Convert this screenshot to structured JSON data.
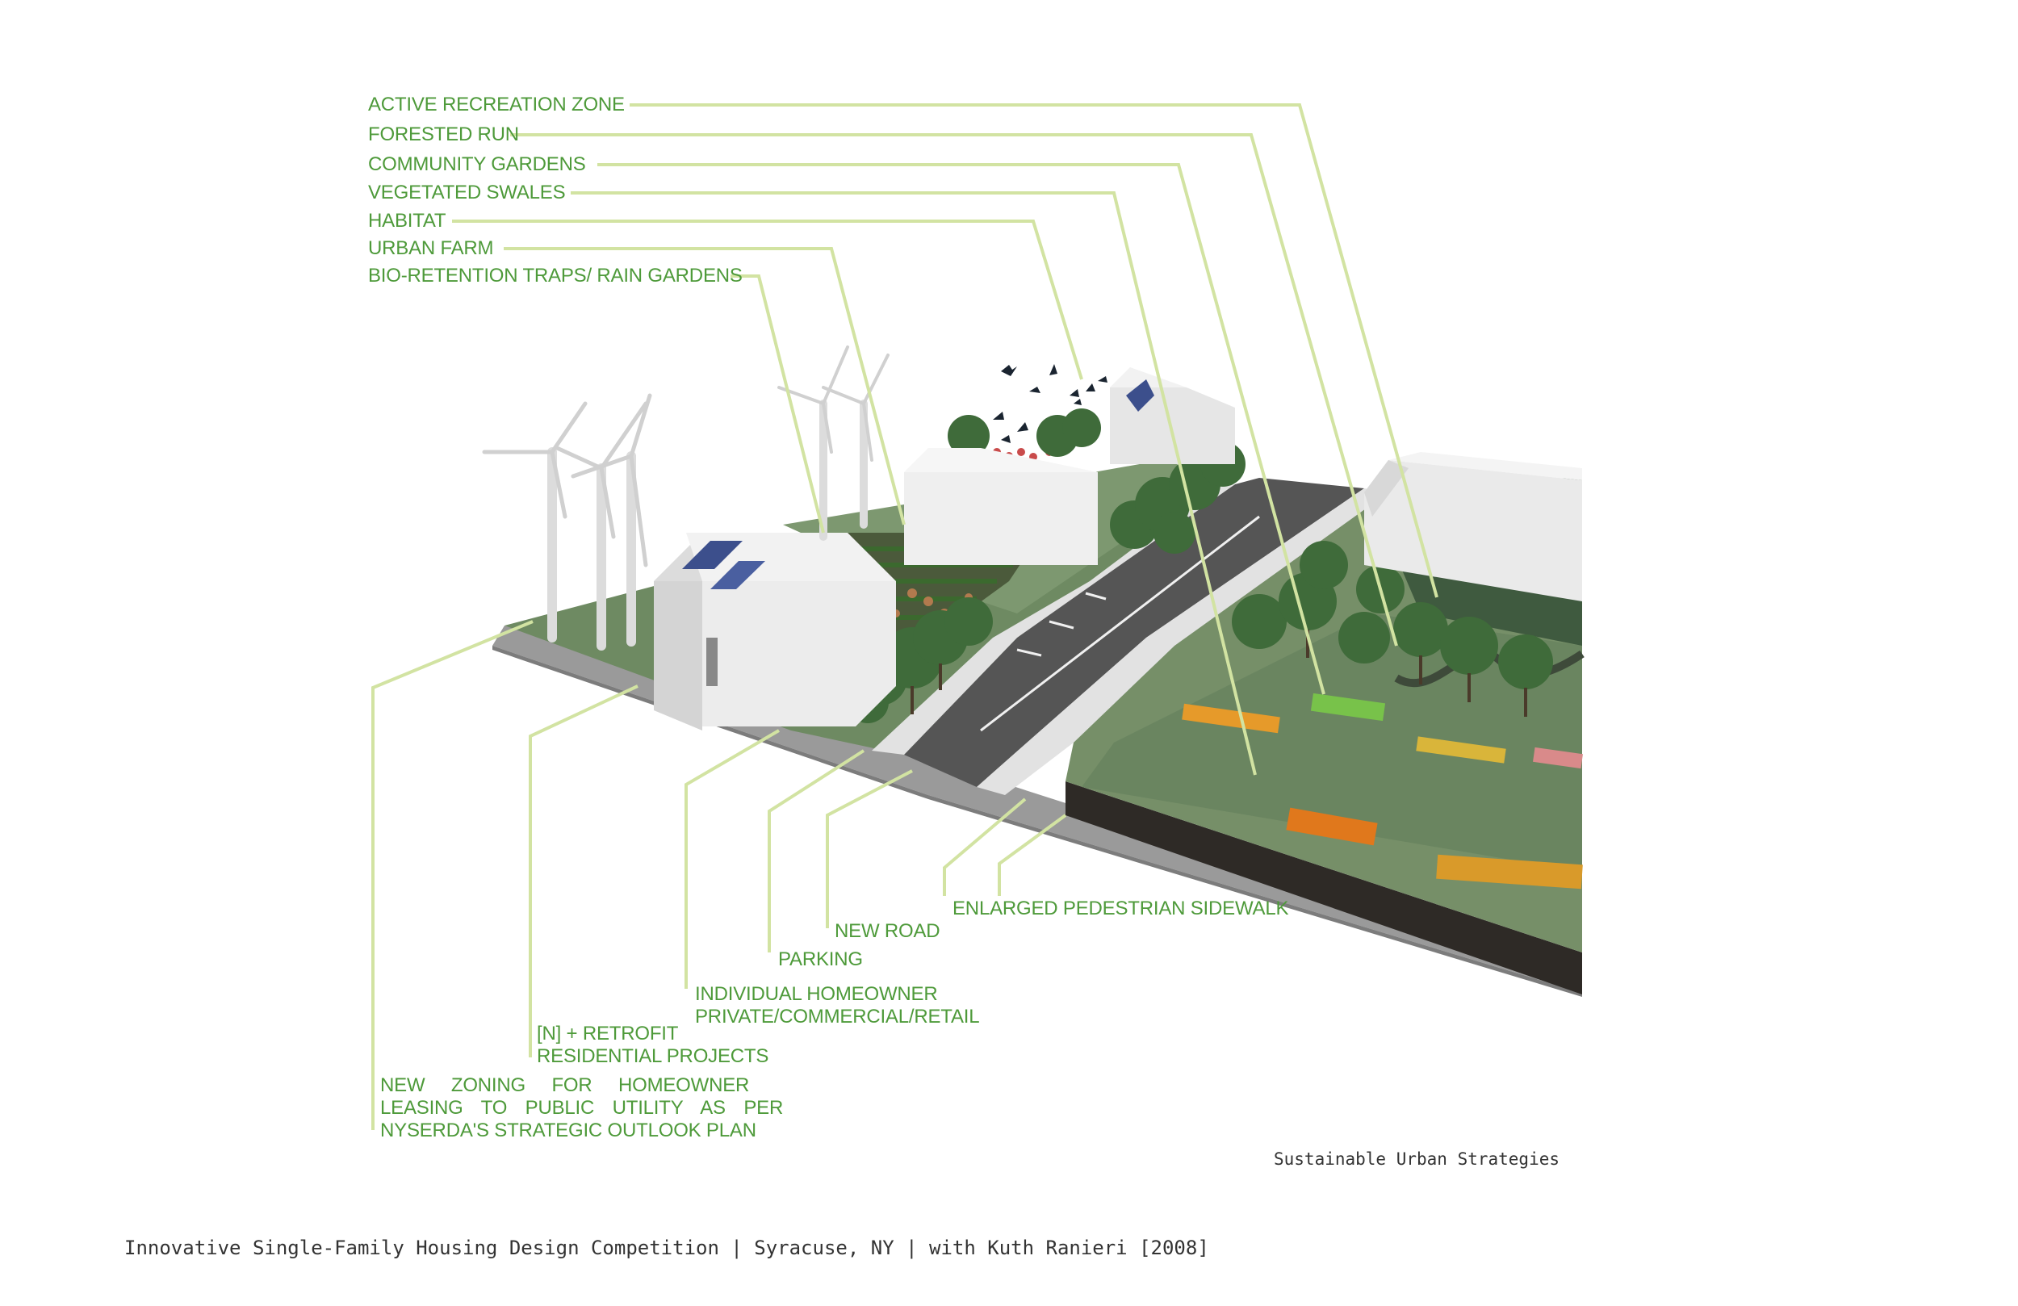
{
  "colors": {
    "label_text": "#4e9a3a",
    "leader_line": "#d2e3a2",
    "grass": "#6e8a62",
    "grass_dark": "#4f6a48",
    "road": "#5a5a5a",
    "sidewalk": "#e2e2e2",
    "building": "#e9e9e9",
    "soil": "#2e2a26"
  },
  "labels_top": [
    {
      "id": "active-recreation-zone",
      "text": "ACTIVE RECREATION ZONE"
    },
    {
      "id": "forested-run",
      "text": "FORESTED RUN"
    },
    {
      "id": "community-gardens",
      "text": "COMMUNITY GARDENS"
    },
    {
      "id": "vegetated-swales",
      "text": "VEGETATED SWALES"
    },
    {
      "id": "habitat",
      "text": "HABITAT"
    },
    {
      "id": "urban-farm",
      "text": "URBAN FARM"
    },
    {
      "id": "bio-retention",
      "text": "BIO-RETENTION TRAPS/ RAIN GARDENS"
    }
  ],
  "labels_bottom": {
    "sidewalk": "ENLARGED PEDESTRIAN SIDEWALK",
    "new_road": "NEW ROAD",
    "parking": "PARKING",
    "homeowner_1": "INDIVIDUAL HOMEOWNER",
    "homeowner_2": "PRIVATE/COMMERCIAL/RETAIL",
    "retrofit_1": "[N] + RETROFIT",
    "retrofit_2": "RESIDENTIAL PROJECTS",
    "zoning_1": "NEW ZONING FOR HOMEOWNER",
    "zoning_2": "LEASING TO PUBLIC UTILITY AS PER",
    "zoning_3": "NYSERDA'S STRATEGIC OUTLOOK PLAN"
  },
  "captions": {
    "sub": "Sustainable Urban Strategies",
    "main": "Innovative Single-Family Housing Design Competition | Syracuse, NY | with Kuth Ranieri [2008]"
  }
}
